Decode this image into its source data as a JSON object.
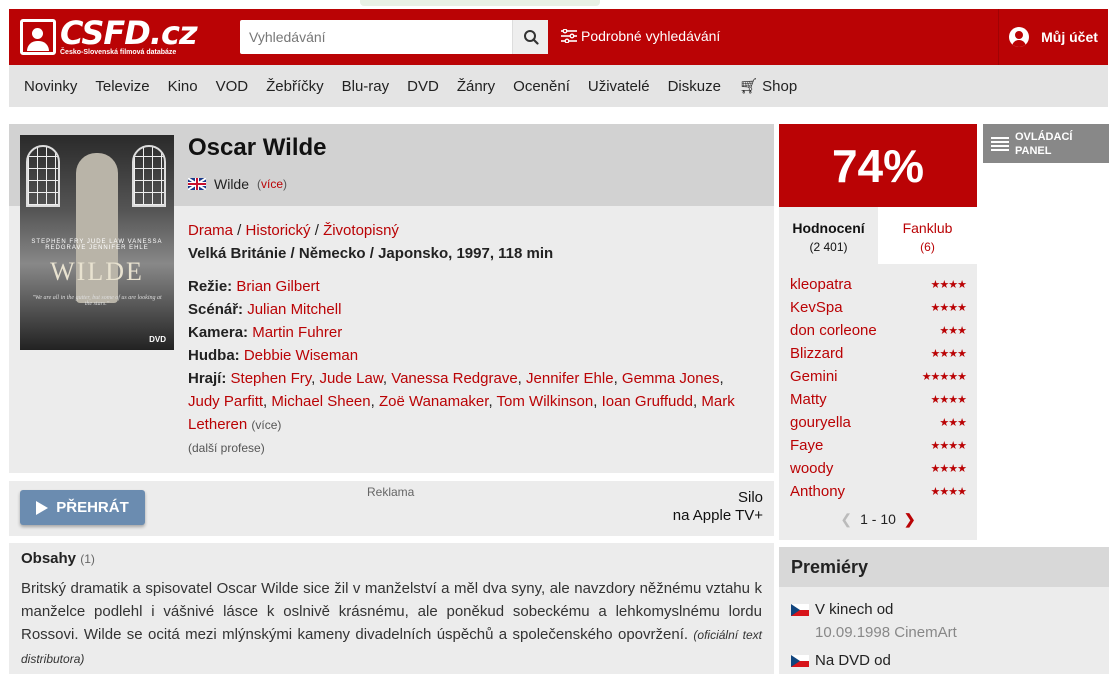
{
  "header": {
    "logo_main": "CSFD.cz",
    "logo_sub": "Česko-Slovenská filmová databáze",
    "search_placeholder": "Vyhledávání",
    "advanced_search": "Podrobné vyhledávání",
    "account": "Můj účet"
  },
  "nav": [
    "Novinky",
    "Televize",
    "Kino",
    "VOD",
    "Žebříčky",
    "Blu-ray",
    "DVD",
    "Žánry",
    "Ocenění",
    "Uživatelé",
    "Diskuze",
    "Shop"
  ],
  "film": {
    "title": "Oscar Wilde",
    "original_title": "Wilde",
    "original_more": "(více)",
    "genres": [
      "Drama",
      "Historický",
      "Životopisný"
    ],
    "origin": "Velká Británie / Německo / Japonsko, 1997, 118 min",
    "directing_label": "Režie:",
    "directing": "Brian Gilbert",
    "writing_label": "Scénář:",
    "writing": "Julian Mitchell",
    "camera_label": "Kamera:",
    "camera": "Martin Fuhrer",
    "music_label": "Hudba:",
    "music": "Debbie Wiseman",
    "cast_label": "Hrají:",
    "cast": [
      "Stephen Fry",
      "Jude Law",
      "Vanessa Redgrave",
      "Jennifer Ehle",
      "Gemma Jones",
      "Judy Parfitt",
      "Michael Sheen",
      "Zoë Wanamaker",
      "Tom Wilkinson",
      "Ioan Gruffudd",
      "Mark Letheren"
    ],
    "cast_more": "(více)",
    "more_professions": "(další profese)",
    "poster": {
      "names": "STEPHEN FRY  JUDE LAW  VANESSA REDGRAVE  JENNIFER EHLE",
      "title": "WILDE",
      "quote": "\"We are all in the gutter, but some of us are looking at the stars.\"",
      "dvd": "DVD"
    }
  },
  "play": {
    "button": "PŘEHRÁT",
    "ad_label": "Reklama",
    "provider_line1": "Silo",
    "provider_line2": "na Apple TV+"
  },
  "plot": {
    "heading": "Obsahy",
    "count": "(1)",
    "text": "Britský dramatik a spisovatel Oscar Wilde sice žil v manželství a měl dva syny, ale navzdory něžnému vztahu k manželce podlehl i vášnivé lásce k oslnivě krásnému, ale poněkud sobeckému a lehkomyslnému lordu Rossovi. Wilde se ocitá mezi mlýnskými kameny divadelních úspěchů a společenského opovržení.",
    "source": "(oficiální text distributora)"
  },
  "rating": {
    "percent": "74%",
    "tab_ratings": "Hodnocení",
    "tab_ratings_count": "(2 401)",
    "tab_fanclub": "Fanklub",
    "tab_fanclub_count": "(6)",
    "users": [
      {
        "name": "kleopatra",
        "stars": "★★★★"
      },
      {
        "name": "KevSpa",
        "stars": "★★★★"
      },
      {
        "name": "don corleone",
        "stars": "★★★"
      },
      {
        "name": "Blizzard",
        "stars": "★★★★"
      },
      {
        "name": "Gemini",
        "stars": "★★★★★"
      },
      {
        "name": "Matty",
        "stars": "★★★★"
      },
      {
        "name": "gouryella",
        "stars": "★★★"
      },
      {
        "name": "Faye",
        "stars": "★★★★"
      },
      {
        "name": "woody",
        "stars": "★★★★"
      },
      {
        "name": "Anthony",
        "stars": "★★★★"
      }
    ],
    "pager": "1 - 10"
  },
  "panel_button": {
    "line1": "OVLÁDACÍ",
    "line2": "PANEL"
  },
  "premieres": {
    "heading": "Premiéry",
    "cinema_label": "V kinech od",
    "cinema_date": "10.09.1998 CinemArt",
    "dvd_label": "Na DVD od"
  }
}
